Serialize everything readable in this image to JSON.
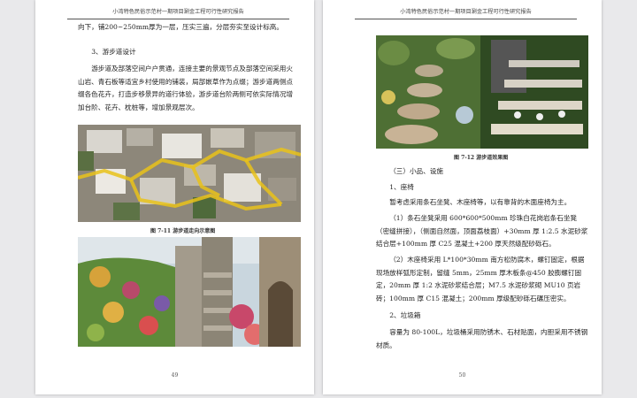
{
  "left_page": {
    "header": "小湾特色民俗示范村一期项目涮金工程可行性研究报告",
    "para_continued": "向下，铺200~250mm厚为一层，压实三遍，分层夯实至设计标高。",
    "section_heading": "3、游步道设计",
    "para_body": "游步道及部落空间户户贯通，连接主要的景观节点及部落空间采用火山岩、青石板等适宜乡村使用的铺装，局部嵌草作为点缀；游步道两侧点缀各色花卉，打造步移景异的道行体验，游步道台阶两侧可依实际情况增加台阶、花卉、枕桩等，增加景观层次。",
    "figure_caption": "图 7-11   游步道走向示意图",
    "page_number": "49"
  },
  "right_page": {
    "header": "小湾特色民俗示范村一期项目涮金工程可行性研究报告",
    "figure_caption": "图 7-12   游步道效果图",
    "section_heading": "（三）小品、设施",
    "sub_heading_1": "1、座椅",
    "para_1": "暂考虑采用条石坐凳、木座椅等，以有靠背的木面座椅为主。",
    "para_2": "（1）条石坐凳采用 600*600*500mm 珍珠白花岗岩条石坐凳（密缝拼接），（侧面自然面，顶面荔枝面）+30mm 厚 1:2.5 水泥砂浆结合层+100mm 厚 C25 混凝土+200 厚天然级配砂砾石。",
    "para_3": "（2）木座椅采用 L*100*30mm 南方松防腐木，螺钉固定，根据现场放样弧形定制，留缝 5mm，25mm 厚木板条@450 胶膨螺钉固定，20mm 厚 1:2 水泥砂浆结合层；M7.5 水泥砂浆砌 MU10 页岩砖；100mm 厚 C15 混凝土；200mm 厚级配砂砾石碾压密实。",
    "sub_heading_2": "2、垃圾箱",
    "para_4": "容量为 80-100L，垃圾桶采用防锈木、石材贴面，内胆采用不锈钢材质。",
    "page_number": "50"
  }
}
